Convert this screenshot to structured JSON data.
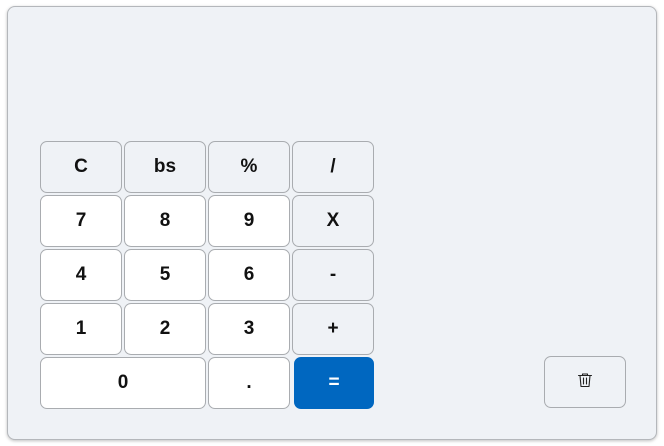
{
  "display": {
    "value": ""
  },
  "keypad": {
    "rows": [
      [
        "C",
        "bs",
        "%",
        "/"
      ],
      [
        "7",
        "8",
        "9",
        "X"
      ],
      [
        "4",
        "5",
        "6",
        "-"
      ],
      [
        "1",
        "2",
        "3",
        "+"
      ],
      [
        "0",
        ".",
        "="
      ]
    ]
  },
  "history": {
    "clear_icon": "trash-icon"
  },
  "colors": {
    "background": "#eff2f6",
    "key": "#ffffff",
    "accent": "#0067c0",
    "border": "#a9acb0"
  }
}
